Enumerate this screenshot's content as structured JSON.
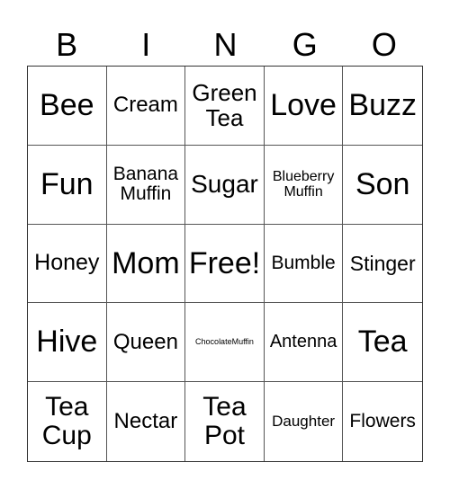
{
  "header": [
    "B",
    "I",
    "N",
    "G",
    "O"
  ],
  "cells": [
    {
      "text": "Bee",
      "size": 34
    },
    {
      "text": "Cream",
      "size": 24
    },
    {
      "text": "Green Tea",
      "size": 26
    },
    {
      "text": "Love",
      "size": 34
    },
    {
      "text": "Buzz",
      "size": 34
    },
    {
      "text": "Fun",
      "size": 34
    },
    {
      "text": "Banana Muffin",
      "size": 21
    },
    {
      "text": "Sugar",
      "size": 28
    },
    {
      "text": "Blueberry Muffin",
      "size": 16
    },
    {
      "text": "Son",
      "size": 34
    },
    {
      "text": "Honey",
      "size": 25
    },
    {
      "text": "Mom",
      "size": 34
    },
    {
      "text": "Free!",
      "size": 34
    },
    {
      "text": "Bumble",
      "size": 21
    },
    {
      "text": "Stinger",
      "size": 23
    },
    {
      "text": "Hive",
      "size": 34
    },
    {
      "text": "Queen",
      "size": 24
    },
    {
      "text": "ChocolateMuffin",
      "size": 9
    },
    {
      "text": "Antenna",
      "size": 20
    },
    {
      "text": "Tea",
      "size": 34
    },
    {
      "text": "Tea Cup",
      "size": 30
    },
    {
      "text": "Nectar",
      "size": 24
    },
    {
      "text": "Tea Pot",
      "size": 30
    },
    {
      "text": "Daughter",
      "size": 17
    },
    {
      "text": "Flowers",
      "size": 21
    }
  ]
}
